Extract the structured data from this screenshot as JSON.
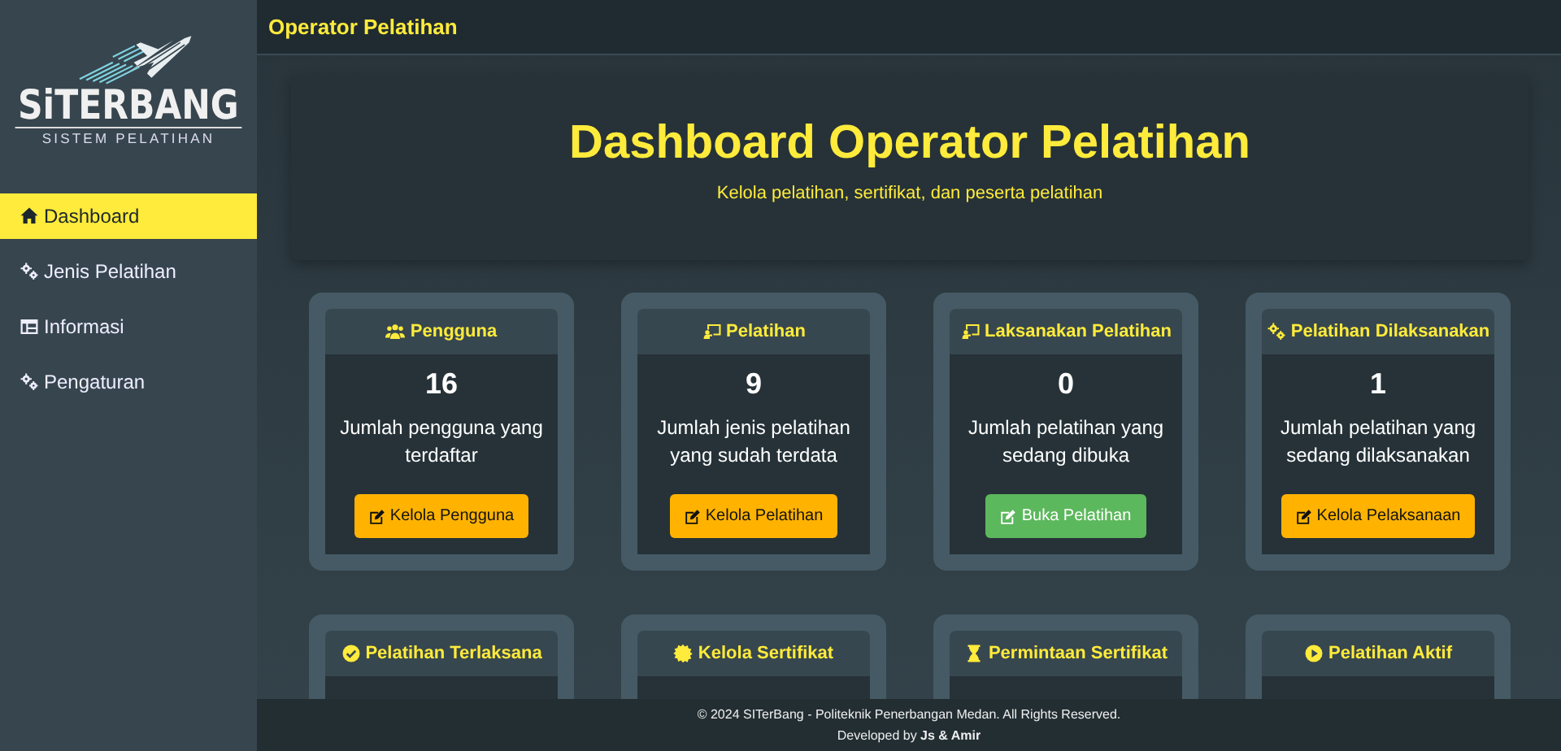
{
  "sidebar": {
    "logo": {
      "name": "SiTERBANG",
      "tagline": "SISTEM PELATIHAN"
    },
    "items": [
      {
        "label": "Dashboard",
        "selected": true
      },
      {
        "label": "Jenis Pelatihan",
        "selected": false
      },
      {
        "label": "Informasi",
        "selected": false
      },
      {
        "label": "Pengaturan",
        "selected": false
      }
    ]
  },
  "topbar": {
    "title": "Operator Pelatihan"
  },
  "hero": {
    "title": "Dashboard Operator Pelatihan",
    "subtitle": "Kelola pelatihan, sertifikat, dan peserta pelatihan"
  },
  "cards": [
    {
      "title": "Pengguna",
      "count": "16",
      "description": "Jumlah pengguna yang terdaftar",
      "button": {
        "label": "Kelola Pengguna",
        "kind": "warning"
      }
    },
    {
      "title": "Pelatihan",
      "count": "9",
      "description": "Jumlah jenis pelatihan yang sudah terdata",
      "button": {
        "label": "Kelola Pelatihan",
        "kind": "warning"
      }
    },
    {
      "title": "Laksanakan Pelatihan",
      "count": "0",
      "description": "Jumlah pelatihan yang sedang dibuka",
      "button": {
        "label": "Buka Pelatihan",
        "kind": "success"
      }
    },
    {
      "title": "Pelatihan Dilaksanakan",
      "count": "1",
      "description": "Jumlah pelatihan yang sedang dilaksanakan",
      "button": {
        "label": "Kelola Pelaksanaan",
        "kind": "warning"
      }
    },
    {
      "title": "Pelatihan Terlaksana"
    },
    {
      "title": "Kelola Sertifikat"
    },
    {
      "title": "Permintaan Sertifikat"
    },
    {
      "title": "Pelatihan Aktif"
    }
  ],
  "footer": {
    "copyright": "© 2024 SITerBang - Politeknik Penerbangan Medan. All Rights Reserved.",
    "credit": "Developed by **Js & Amir**"
  }
}
